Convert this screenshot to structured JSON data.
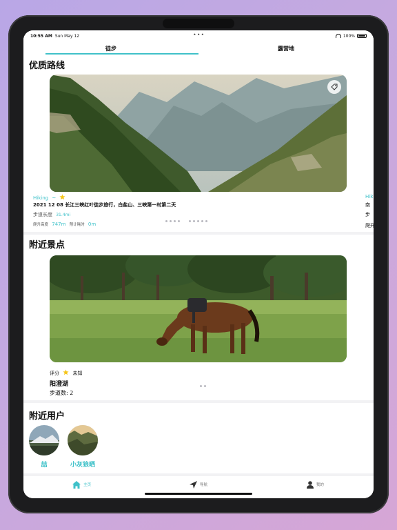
{
  "status_bar": {
    "time": "10:55 AM",
    "date": "Sun May 12",
    "battery": "100%"
  },
  "top_tabs": [
    {
      "label": "徒步",
      "active": true
    },
    {
      "label": "露营地",
      "active": false
    }
  ],
  "routes": {
    "title": "优质路线",
    "card": {
      "activity": "Hiking",
      "separator": "~",
      "description": "2021 12 08 长江三峡红叶徒步旅行，白盐山、三峡第一村第二天",
      "length_label": "步道长度",
      "length_value": "31.4mi",
      "elevation_label": "爬升高度",
      "elevation_value": "747m",
      "time_label": "预计耗时",
      "time_value": "0m"
    },
    "peek": {
      "activity": "Hik",
      "line1": "南",
      "line2": "步",
      "line3": "爬升"
    },
    "pager_dots": 9
  },
  "nearby_spots": {
    "title": "附近景点",
    "card": {
      "rating_label": "评分",
      "rating_value": "未知",
      "name": "阳澄湖",
      "trails_label": "步道数: 2"
    },
    "pager_dots": 2
  },
  "nearby_users": {
    "title": "附近用户",
    "users": [
      {
        "name": "喆"
      },
      {
        "name": "小灰狼晒"
      }
    ]
  },
  "tab_bar": [
    {
      "label": "主页",
      "icon": "home-icon",
      "active": true
    },
    {
      "label": "导航",
      "icon": "navigation-arrow-icon",
      "active": false
    },
    {
      "label": "我的",
      "icon": "person-icon",
      "active": false
    }
  ],
  "colors": {
    "accent": "#3fc1c9",
    "star": "#f5c518"
  }
}
